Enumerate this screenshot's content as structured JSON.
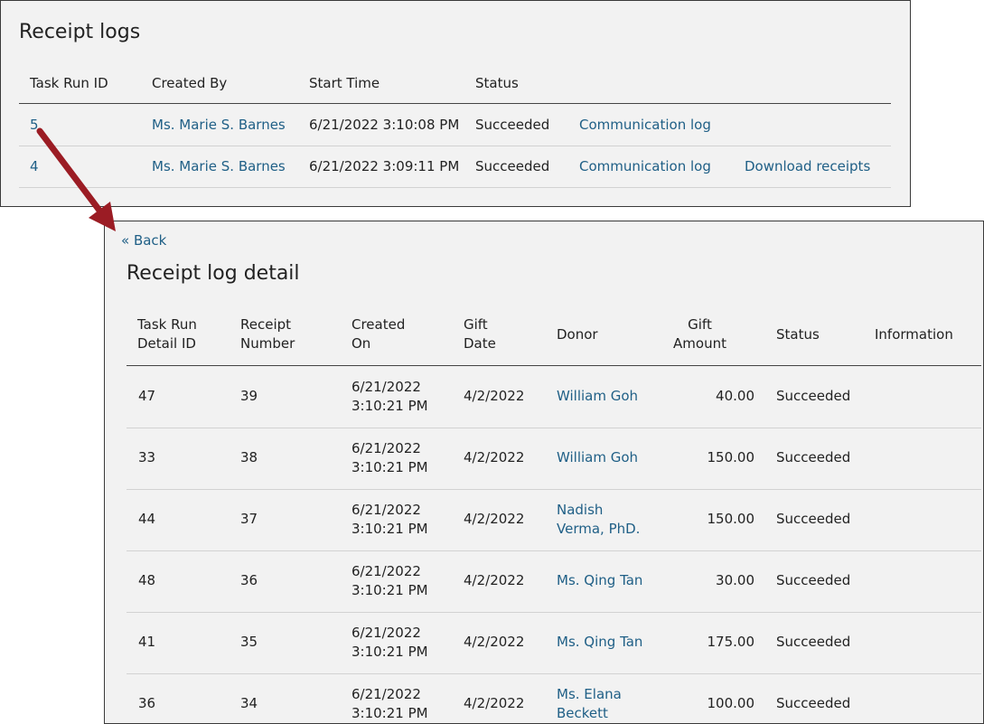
{
  "logs": {
    "title": "Receipt logs",
    "headers": [
      "Task Run ID",
      "Created By",
      "Start Time",
      "Status"
    ],
    "rows": [
      {
        "id": "5",
        "created_by": "Ms. Marie S. Barnes",
        "start_time": "6/21/2022 3:10:08 PM",
        "status": "Succeeded",
        "comm_link": "Communication log",
        "download_link": ""
      },
      {
        "id": "4",
        "created_by": "Ms. Marie S. Barnes",
        "start_time": "6/21/2022 3:09:11 PM",
        "status": "Succeeded",
        "comm_link": "Communication log",
        "download_link": "Download receipts"
      }
    ]
  },
  "detail": {
    "back_label": "« Back",
    "title": "Receipt log detail",
    "headers": {
      "task_run_detail_id": [
        "Task Run",
        "Detail ID"
      ],
      "receipt_number": [
        "Receipt",
        "Number"
      ],
      "created_on": [
        "Created",
        "On"
      ],
      "gift_date": [
        "Gift",
        "Date"
      ],
      "donor": "Donor",
      "gift_amount": [
        "Gift",
        "Amount"
      ],
      "status": "Status",
      "information": "Information"
    },
    "rows": [
      {
        "detail_id": "47",
        "receipt_number": "39",
        "created_date": "6/21/2022",
        "created_time": "3:10:21 PM",
        "gift_date": "4/2/2022",
        "donor_line1": "William Goh",
        "donor_line2": "",
        "amount": "40.00",
        "status": "Succeeded"
      },
      {
        "detail_id": "33",
        "receipt_number": "38",
        "created_date": "6/21/2022",
        "created_time": "3:10:21 PM",
        "gift_date": "4/2/2022",
        "donor_line1": "William Goh",
        "donor_line2": "",
        "amount": "150.00",
        "status": "Succeeded"
      },
      {
        "detail_id": "44",
        "receipt_number": "37",
        "created_date": "6/21/2022",
        "created_time": "3:10:21 PM",
        "gift_date": "4/2/2022",
        "donor_line1": "Nadish",
        "donor_line2": "Verma, PhD.",
        "amount": "150.00",
        "status": "Succeeded"
      },
      {
        "detail_id": "48",
        "receipt_number": "36",
        "created_date": "6/21/2022",
        "created_time": "3:10:21 PM",
        "gift_date": "4/2/2022",
        "donor_line1": "Ms. Qing Tan",
        "donor_line2": "",
        "amount": "30.00",
        "status": "Succeeded"
      },
      {
        "detail_id": "41",
        "receipt_number": "35",
        "created_date": "6/21/2022",
        "created_time": "3:10:21 PM",
        "gift_date": "4/2/2022",
        "donor_line1": "Ms. Qing Tan",
        "donor_line2": "",
        "amount": "175.00",
        "status": "Succeeded"
      },
      {
        "detail_id": "36",
        "receipt_number": "34",
        "created_date": "6/21/2022",
        "created_time": "3:10:21 PM",
        "gift_date": "4/2/2022",
        "donor_line1": "Ms. Elana",
        "donor_line2": "Beckett",
        "amount": "100.00",
        "status": "Succeeded"
      }
    ]
  },
  "colors": {
    "link": "#1f5f86",
    "panel_bg": "#f2f2f2",
    "arrow": "#9b1c24"
  }
}
